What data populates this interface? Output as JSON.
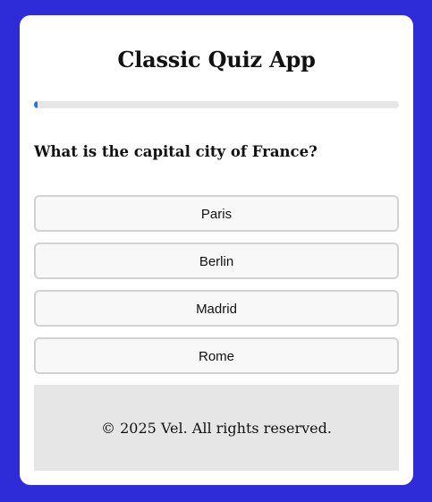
{
  "app": {
    "title": "Classic Quiz App"
  },
  "progress": {
    "fraction": 0.01
  },
  "question": {
    "text": "What is the capital city of France?"
  },
  "options": [
    {
      "label": "Paris"
    },
    {
      "label": "Berlin"
    },
    {
      "label": "Madrid"
    },
    {
      "label": "Rome"
    }
  ],
  "footer": {
    "text": "© 2025 Vel. All rights reserved."
  },
  "colors": {
    "background": "#2e2bd9",
    "card": "#ffffff",
    "progress_fill": "#2a6ff0",
    "progress_track": "#e6e6e6",
    "option_bg": "#f8f8f8",
    "option_border": "#d2d2d2",
    "footer_bg": "#e6e6e6"
  }
}
